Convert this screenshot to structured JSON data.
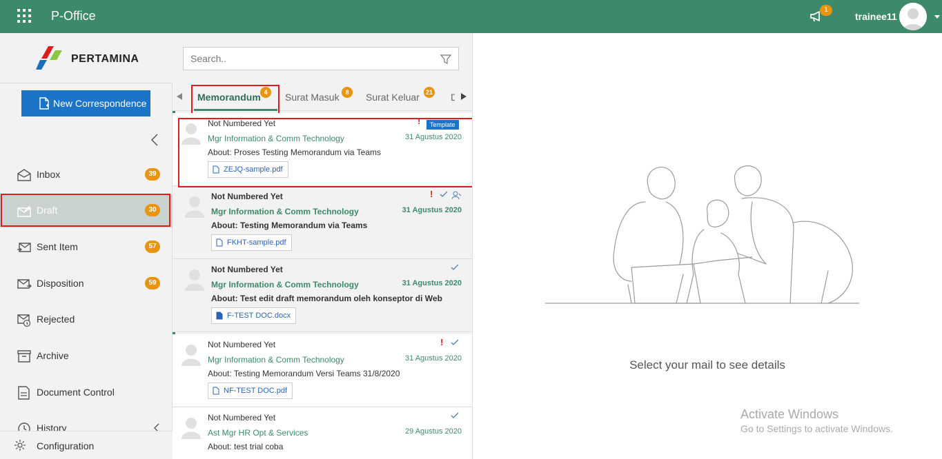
{
  "header": {
    "app_title": "P-Office",
    "announcement_count": "1",
    "username": "trainee11",
    "accent": "#3d8a6a"
  },
  "sidebar": {
    "logo_text": "PERTAMINA",
    "new_button": "New Correspondence",
    "items": [
      {
        "label": "Inbox",
        "badge": "39",
        "icon": "inbox-icon"
      },
      {
        "label": "Draft",
        "badge": "30",
        "icon": "draft-icon",
        "active": true
      },
      {
        "label": "Sent Item",
        "badge": "57",
        "icon": "sent-icon"
      },
      {
        "label": "Disposition",
        "badge": "59",
        "icon": "disposition-icon"
      },
      {
        "label": "Rejected",
        "badge": "",
        "icon": "rejected-icon"
      },
      {
        "label": "Archive",
        "badge": "",
        "icon": "archive-icon"
      },
      {
        "label": "Document Control",
        "badge": "",
        "icon": "document-control-icon"
      },
      {
        "label": "History",
        "badge": "",
        "icon": "history-icon"
      }
    ],
    "config_label": "Configuration"
  },
  "list": {
    "search_placeholder": "Search..",
    "tabs": [
      {
        "label": "Memorandum",
        "badge": "4"
      },
      {
        "label": "Surat Masuk",
        "badge": "8"
      },
      {
        "label": "Surat Keluar",
        "badge": "21"
      },
      {
        "label": "D",
        "badge": ""
      }
    ],
    "mails": [
      {
        "number": "Not Numbered Yet",
        "sender": "Mgr Information & Comm Technology",
        "about": "About: Proses Testing Memorandum via Teams",
        "date": "31 Agustus 2020",
        "attachment": "ZEJQ-sample.pdf",
        "tag": "Template",
        "important": true,
        "unread": false
      },
      {
        "number": "Not Numbered Yet",
        "sender": "Mgr Information & Comm Technology",
        "about": "About: Testing Memorandum via Teams",
        "date": "31 Agustus 2020",
        "attachment": "FKHT-sample.pdf",
        "important": true,
        "unread": true
      },
      {
        "number": "Not Numbered Yet",
        "sender": "Mgr Information & Comm Technology",
        "about": "About: Test edit draft memorandum oleh konseptor di Web",
        "date": "31 Agustus 2020",
        "attachment": "F-TEST DOC.docx",
        "important": false,
        "unread": true
      },
      {
        "number": "Not Numbered Yet",
        "sender": "Mgr Information & Comm Technology",
        "about": "About: Testing Memorandum Versi Teams 31/8/2020",
        "date": "31 Agustus 2020",
        "attachment": "NF-TEST DOC.pdf",
        "important": true,
        "unread": false
      },
      {
        "number": "Not Numbered Yet",
        "sender": "Ast Mgr HR Opt & Services",
        "about": "About: test trial coba",
        "date": "29 Agustus 2020",
        "attachment": "",
        "important": false,
        "unread": false
      }
    ]
  },
  "detail": {
    "empty_message": "Select your mail to see details",
    "watermark_title": "Activate Windows",
    "watermark_sub": "Go to Settings to activate Windows."
  }
}
